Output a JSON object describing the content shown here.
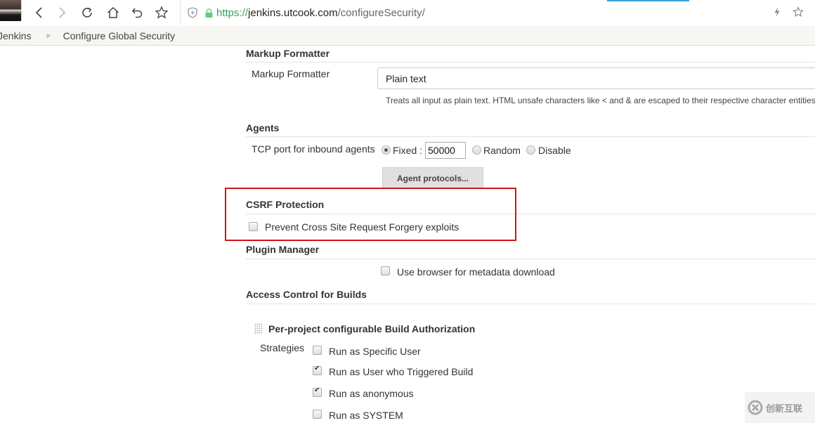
{
  "browser": {
    "url": {
      "scheme": "https://",
      "host": "jenkins.utcook.com",
      "path": "/configureSecurity/"
    },
    "nav_icons": [
      "back-icon",
      "forward-icon",
      "reload-icon",
      "home-icon",
      "undo-icon",
      "bookmark-star-icon"
    ],
    "right_icons": [
      "lightning-icon",
      "star-icon"
    ]
  },
  "breadcrumb": {
    "items": [
      "Jenkins",
      "Configure Global Security"
    ]
  },
  "sections": {
    "markup_formatter": {
      "header": "Markup Formatter",
      "label": "Markup Formatter",
      "selected": "Plain text",
      "help": "Treats all input as plain text. HTML unsafe characters like < and & are escaped to their respective character entities."
    },
    "agents": {
      "header": "Agents",
      "tcp_label": "TCP port for inbound agents",
      "options": [
        {
          "label": "Fixed :",
          "checked": true
        },
        {
          "label": "Random",
          "checked": false
        },
        {
          "label": "Disable",
          "checked": false
        }
      ],
      "port_value": "50000",
      "protocols_button": "Agent protocols..."
    },
    "csrf": {
      "header": "CSRF Protection",
      "checkbox_label": "Prevent Cross Site Request Forgery exploits",
      "checked": false,
      "highlight_color": "#d0141e"
    },
    "plugin_manager": {
      "header": "Plugin Manager",
      "checkbox_label": "Use browser for metadata download",
      "checked": false
    },
    "access_control": {
      "header": "Access Control for Builds",
      "subsection": "Per-project configurable Build Authorization",
      "strategies_label": "Strategies",
      "strategies": [
        {
          "label": "Run as Specific User",
          "checked": false
        },
        {
          "label": "Run as User who Triggered Build",
          "checked": true
        },
        {
          "label": "Run as anonymous",
          "checked": true
        },
        {
          "label": "Run as SYSTEM",
          "checked": false
        }
      ]
    }
  },
  "watermark": {
    "text": "创新互联"
  }
}
